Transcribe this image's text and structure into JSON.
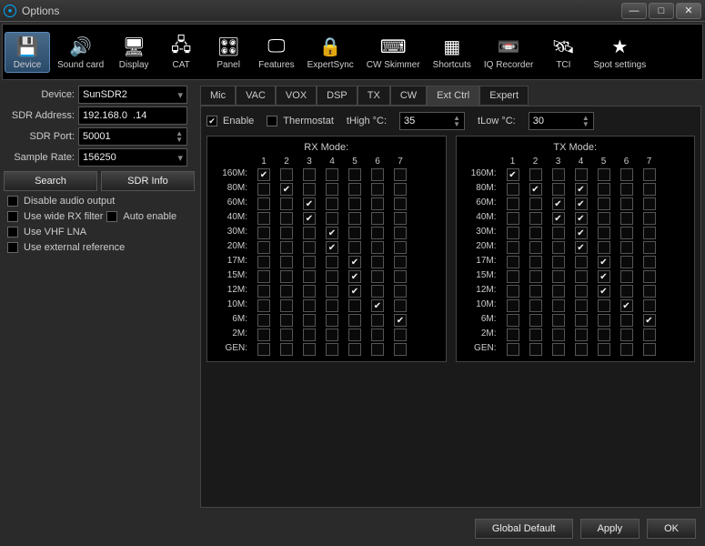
{
  "window": {
    "title": "Options"
  },
  "toolbar": [
    {
      "label": "Device",
      "icon": "💾",
      "active": true
    },
    {
      "label": "Sound card",
      "icon": "🔊"
    },
    {
      "label": "Display",
      "icon": "🖥"
    },
    {
      "label": "CAT",
      "icon": "🖧"
    },
    {
      "label": "Panel",
      "icon": "🎛"
    },
    {
      "label": "Features",
      "icon": "🖵"
    },
    {
      "label": "ExpertSync",
      "icon": "🔒"
    },
    {
      "label": "CW Skimmer",
      "icon": "⌨"
    },
    {
      "label": "Shortcuts",
      "icon": "▦"
    },
    {
      "label": "IQ Recorder",
      "icon": "📼"
    },
    {
      "label": "TCI",
      "icon": "🛰"
    },
    {
      "label": "Spot settings",
      "icon": "★"
    }
  ],
  "left": {
    "device_label": "Device:",
    "device_value": "SunSDR2",
    "addr_label": "SDR Address:",
    "addr_value": "192.168.0  .14",
    "port_label": "SDR Port:",
    "port_value": "50001",
    "rate_label": "Sample Rate:",
    "rate_value": "156250",
    "search_btn": "Search",
    "info_btn": "SDR Info",
    "disable_audio": "Disable audio output",
    "wide_rx": "Use wide RX filter",
    "auto_enable": "Auto enable",
    "vhf_lna": "Use VHF LNA",
    "ext_ref": "Use external reference"
  },
  "tabs": [
    "Mic",
    "VAC",
    "VOX",
    "DSP",
    "TX",
    "CW",
    "Ext Ctrl",
    "Expert"
  ],
  "active_tab": "Ext Ctrl",
  "extctrl": {
    "enable_label": "Enable",
    "enable_checked": true,
    "thermostat_label": "Thermostat",
    "thermostat_checked": false,
    "thigh_label": "tHigh °C:",
    "thigh_value": "35",
    "tlow_label": "tLow °C:",
    "tlow_value": "30"
  },
  "columns": [
    "1",
    "2",
    "3",
    "4",
    "5",
    "6",
    "7"
  ],
  "bands": [
    "160M",
    "80M",
    "60M",
    "40M",
    "30M",
    "20M",
    "17M",
    "15M",
    "12M",
    "10M",
    "6M",
    "2M",
    "GEN"
  ],
  "rx_title": "RX Mode:",
  "tx_title": "TX Mode:",
  "rx_checked": {
    "160M": [
      1
    ],
    "80M": [
      2
    ],
    "60M": [
      3
    ],
    "40M": [
      3
    ],
    "30M": [
      4
    ],
    "20M": [
      4
    ],
    "17M": [
      5
    ],
    "15M": [
      5
    ],
    "12M": [
      5
    ],
    "10M": [
      6
    ],
    "6M": [
      7
    ],
    "2M": [],
    "GEN": []
  },
  "tx_checked": {
    "160M": [
      1
    ],
    "80M": [
      2,
      4
    ],
    "60M": [
      3,
      4
    ],
    "40M": [
      3,
      4
    ],
    "30M": [
      4
    ],
    "20M": [
      4
    ],
    "17M": [
      5
    ],
    "15M": [
      5
    ],
    "12M": [
      5
    ],
    "10M": [
      6
    ],
    "6M": [
      7
    ],
    "2M": [],
    "GEN": []
  },
  "footer": {
    "global_default": "Global Default",
    "apply": "Apply",
    "ok": "OK"
  }
}
